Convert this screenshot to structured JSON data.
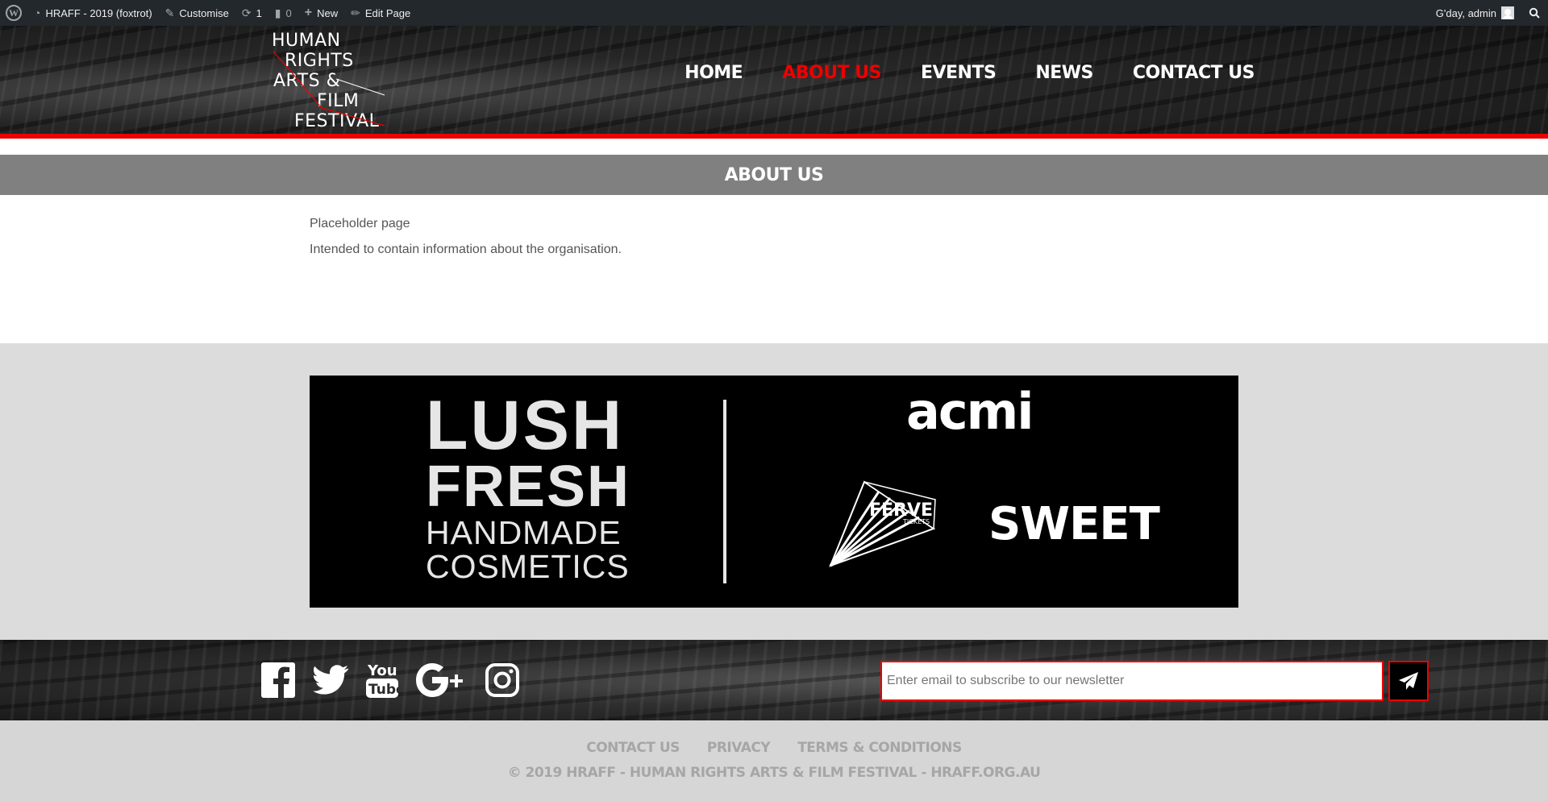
{
  "admin_bar": {
    "site_name": "HRAFF - 2019 (foxtrot)",
    "customise": "Customise",
    "updates_count": "1",
    "comments_count": "0",
    "new_label": "New",
    "edit_page": "Edit Page",
    "greeting": "G'day, admin"
  },
  "header": {
    "logo_lines": [
      "HUMAN",
      "RIGHTS",
      "ARTS &",
      "FILM",
      "FESTIVAL"
    ],
    "nav": [
      {
        "label": "HOME",
        "active": false
      },
      {
        "label": "ABOUT US",
        "active": true
      },
      {
        "label": "EVENTS",
        "active": false
      },
      {
        "label": "NEWS",
        "active": false
      },
      {
        "label": "CONTACT US",
        "active": false
      }
    ]
  },
  "page": {
    "title": "ABOUT US",
    "paragraphs": [
      "Placeholder page",
      "Intended to contain information about the organisation."
    ]
  },
  "sponsors": {
    "lush_lines": [
      "LUSH",
      "FRESH",
      "HANDMADE",
      "COSMETICS"
    ],
    "acmi": "acmi",
    "ferve": "FERVE",
    "ferve_sub": "TICKETS",
    "sweet": "SWEET"
  },
  "footer": {
    "social_icons": [
      "facebook-icon",
      "twitter-icon",
      "youtube-icon",
      "google-plus-icon",
      "instagram-icon"
    ],
    "newsletter_placeholder": "Enter email to subscribe to our newsletter",
    "links": [
      "CONTACT US",
      "PRIVACY",
      "TERMS & CONDITIONS"
    ],
    "copyright": "© 2019 HRAFF - HUMAN RIGHTS ARTS & FILM FESTIVAL - HRAFF.ORG.AU"
  },
  "colors": {
    "accent": "#ee0000",
    "admin_bar": "#23282d",
    "title_bar": "#808080",
    "sponsor_bg": "#dcdcdc",
    "footer_bottom": "#d6d6d6"
  }
}
